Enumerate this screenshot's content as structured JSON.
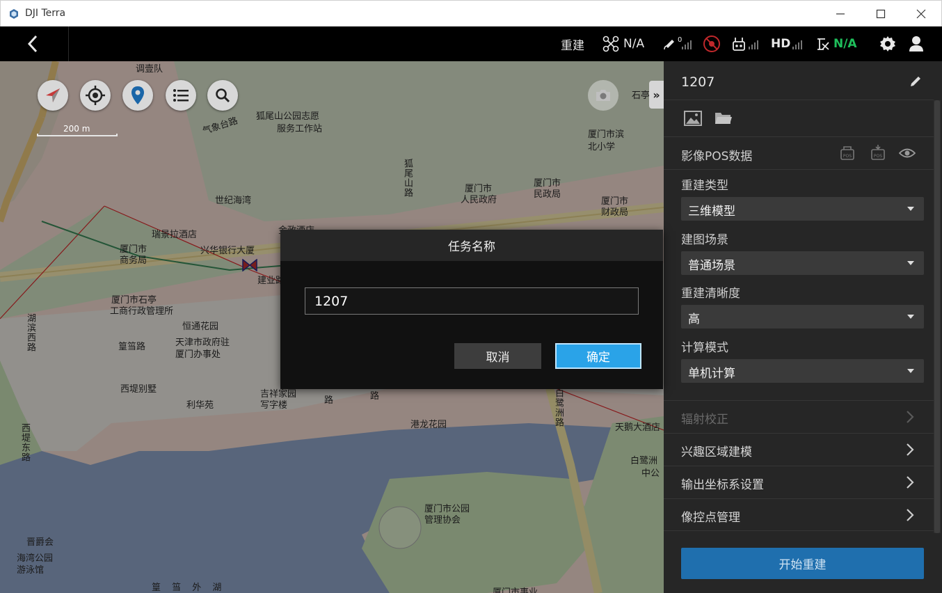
{
  "window": {
    "title": "DJI Terra",
    "minimize_icon": "minimize-icon",
    "maximize_icon": "maximize-icon",
    "close_icon": "close-icon"
  },
  "topbar": {
    "back_icon": "chevron-left-icon",
    "mode_label": "重建",
    "aircraft_status": "N/A",
    "satellite_count": "0",
    "hd_label": "HD",
    "rtk_status": "N/A",
    "accent_green": "#1fbf5b"
  },
  "map": {
    "scale_label": "200 m",
    "tools": [
      "compass-icon",
      "locate-icon",
      "location-pin-icon",
      "list-icon",
      "search-icon"
    ],
    "camera_icon": "camera-icon",
    "collapse_label": "»",
    "labels": {
      "l1": "调壹队",
      "l2": "狐尾山公园志愿",
      "l3": "服务工作站",
      "l4": "气象台路",
      "l5": "厦门市滨",
      "l6": "北小学",
      "l7": "狐尾山路",
      "l8": "世纪海湾",
      "l9": "厦门市",
      "l10": "人民政府",
      "l11": "厦门市",
      "l12": "民政局",
      "l13": "厦门市",
      "l14": "财政局",
      "l15": "瑞景拉酒店",
      "l16": "金政酒店",
      "l17": "厦门市",
      "l18": "商务局",
      "l19": "兴华银行大厦",
      "l20": "建业路",
      "l21": "厦门市石亭",
      "l22": "工商行政管理所",
      "l23": "恒通花园",
      "l24": "湖滨西路",
      "l25": "篁筜路",
      "l26": "天津市政府驻",
      "l27": "厦门办事处",
      "l28": "西堤别墅",
      "l29": "利华苑",
      "l30": "吉祥家园",
      "l31": "写字楼",
      "l32": "港龙花园",
      "l33": "白鹭洲路",
      "l34": "天鹅大酒店",
      "l35": "白鹭洲",
      "l36": "中公",
      "l37": "西堤东路",
      "l38": "厦门市公园",
      "l39": "管理协会",
      "l40": "晋爵会",
      "l41": "海湾公园",
      "l42": "游泳馆",
      "l43": "篁 筜 外 湖",
      "l44": "厦门市事业",
      "l45": "石亭",
      "l46": "路",
      "l47": "路"
    }
  },
  "panel": {
    "title": "1207",
    "edit_icon": "pencil-icon",
    "image_icon": "image-icon",
    "folder_icon": "folder-icon",
    "pos_label": "影像POS数据",
    "pos_import_icon": "pos-import-icon",
    "pos_export_icon": "pos-export-icon",
    "pos_view_icon": "eye-icon",
    "recon_type_label": "重建类型",
    "recon_type_value": "三维模型",
    "scene_label": "建图场景",
    "scene_value": "普通场景",
    "resolution_label": "重建清晰度",
    "resolution_value": "高",
    "compute_label": "计算模式",
    "compute_value": "单机计算",
    "menu": [
      "辐射校正",
      "兴趣区域建模",
      "输出坐标系设置",
      "像控点管理"
    ],
    "start_button": "开始重建"
  },
  "dialog": {
    "title": "任务名称",
    "input_value": "1207",
    "cancel_label": "取消",
    "ok_label": "确定",
    "ok_color": "#2aa3e8"
  }
}
